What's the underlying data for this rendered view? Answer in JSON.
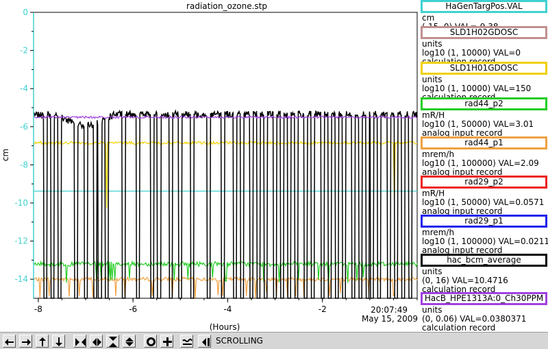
{
  "chart_data": {
    "type": "line",
    "title": "radiation_ozone.stp",
    "xlabel": "(Hours)",
    "ylabel": "cm",
    "xlim": [
      -8.1,
      0
    ],
    "ylim": [
      -15,
      0
    ],
    "x_ticks": [
      "-8",
      "-6",
      "-4",
      "-2"
    ],
    "y_ticks": [
      "0",
      "-2",
      "-4",
      "-6",
      "-8",
      "-10",
      "-12",
      "-14"
    ],
    "y_axis_color": "#40d0d0",
    "timestamp_time": "20:07:49",
    "timestamp_date": "May 15, 2009",
    "series": [
      {
        "name": "HaGenTargPos.VAL",
        "color": "#40d0d0",
        "baseline": -9.38
      },
      {
        "name": "SLD1H02GDOSC",
        "color": "#c09090",
        "baseline": null
      },
      {
        "name": "SLD1H01GDOSC",
        "color": "#f0d000",
        "baseline": -6.85
      },
      {
        "name": "rad44_p2",
        "color": "#22cc22",
        "baseline": -13.2
      },
      {
        "name": "rad44_p1",
        "color": "#f0a040",
        "baseline": -14.0
      },
      {
        "name": "rad29_p2",
        "color": "#ee2020",
        "baseline": null
      },
      {
        "name": "rad29_p1",
        "color": "#2020ee",
        "baseline": null
      },
      {
        "name": "hac_bcm_average",
        "color": "#000000",
        "baseline": -5.35
      },
      {
        "name": "HacB_HPE1313A:0_Ch30PPM",
        "color": "#a040e0",
        "baseline": -5.5
      }
    ]
  },
  "legend": [
    {
      "name": "HaGenTargPos.VAL",
      "color": "#40d0d0",
      "units": "cm",
      "range": "(-15, 0) VAL=-9.38",
      "record": ""
    },
    {
      "name": "SLD1H02GDOSC",
      "color": "#c09090",
      "units": "units",
      "range": "log10 (1, 10000)  VAL=0",
      "record": "calculation record"
    },
    {
      "name": "SLD1H01GDOSC",
      "color": "#f0d000",
      "units": "units",
      "range": "log10 (1, 10000) VAL=150",
      "record": "calculation record"
    },
    {
      "name": "rad44_p2",
      "color": "#22cc22",
      "units": "mR/H",
      "range": "log10 (1, 50000) VAL=3.01",
      "record": "analog input record"
    },
    {
      "name": "rad44_p1",
      "color": "#f0a040",
      "units": "mrem/h",
      "range": "log10 (1, 100000) VAL=2.09",
      "record": "analog input record"
    },
    {
      "name": "rad29_p2",
      "color": "#ee2020",
      "units": "mR/H",
      "range": "log10 (1, 50000) VAL=0.0571",
      "record": "analog input record"
    },
    {
      "name": "rad29_p1",
      "color": "#2020ee",
      "units": "mrem/h",
      "range": "log10 (1, 100000) VAL=0.0211",
      "record": "analog input record"
    },
    {
      "name": "hac_bcm_average",
      "color": "#000000",
      "units": "units",
      "range": "(0, 16) VAL=10.4716",
      "record": "calculation record"
    },
    {
      "name": "HacB_HPE1313A:0_Ch30PPM",
      "color": "#a040e0",
      "units": "units",
      "range": "(0, 0.06) VAL=0.0380371",
      "record": "calculation record"
    }
  ],
  "toolbar": {
    "mode_label": "SCROLLING",
    "buttons": [
      {
        "icon": "arrow-left-icon"
      },
      {
        "icon": "arrow-right-icon"
      },
      {
        "icon": "arrow-up-icon"
      },
      {
        "icon": "arrow-down-icon"
      },
      {
        "icon": "zoom-in-horizontal-icon"
      },
      {
        "icon": "zoom-out-horizontal-icon"
      },
      {
        "icon": "zoom-in-vertical-icon"
      },
      {
        "icon": "zoom-out-vertical-icon"
      },
      {
        "icon": "circle-icon"
      },
      {
        "icon": "plus-icon"
      },
      {
        "icon": "wave-icon"
      },
      {
        "icon": "scroll-left-icon"
      }
    ]
  }
}
